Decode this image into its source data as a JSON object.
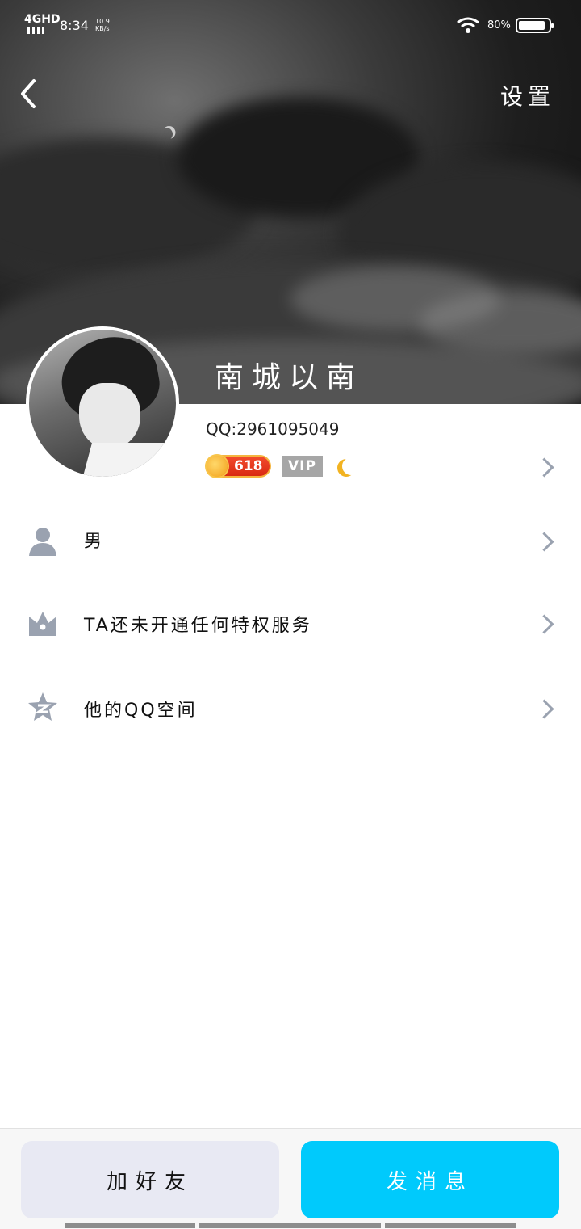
{
  "status_bar": {
    "network": "4GHD",
    "time": "8:34",
    "speed_value": "10.9",
    "speed_unit": "KB/s",
    "battery_percent": "80%"
  },
  "header": {
    "settings_label": "设置"
  },
  "profile": {
    "nickname": "南城以南",
    "qq_label": "QQ:2961095049",
    "level_badge": "618",
    "vip_badge": "VIP"
  },
  "rows": [
    {
      "label": "男",
      "icon": "person-icon"
    },
    {
      "label": "TA还未开通任何特权服务",
      "icon": "crown-icon"
    },
    {
      "label": "他的QQ空间",
      "icon": "qzone-star-icon"
    }
  ],
  "actions": {
    "add_friend": "加好友",
    "send_message": "发消息"
  },
  "colors": {
    "primary_button": "#00cafc",
    "secondary_button": "#e8e9f3",
    "icon_gray": "#9aa2b0"
  }
}
